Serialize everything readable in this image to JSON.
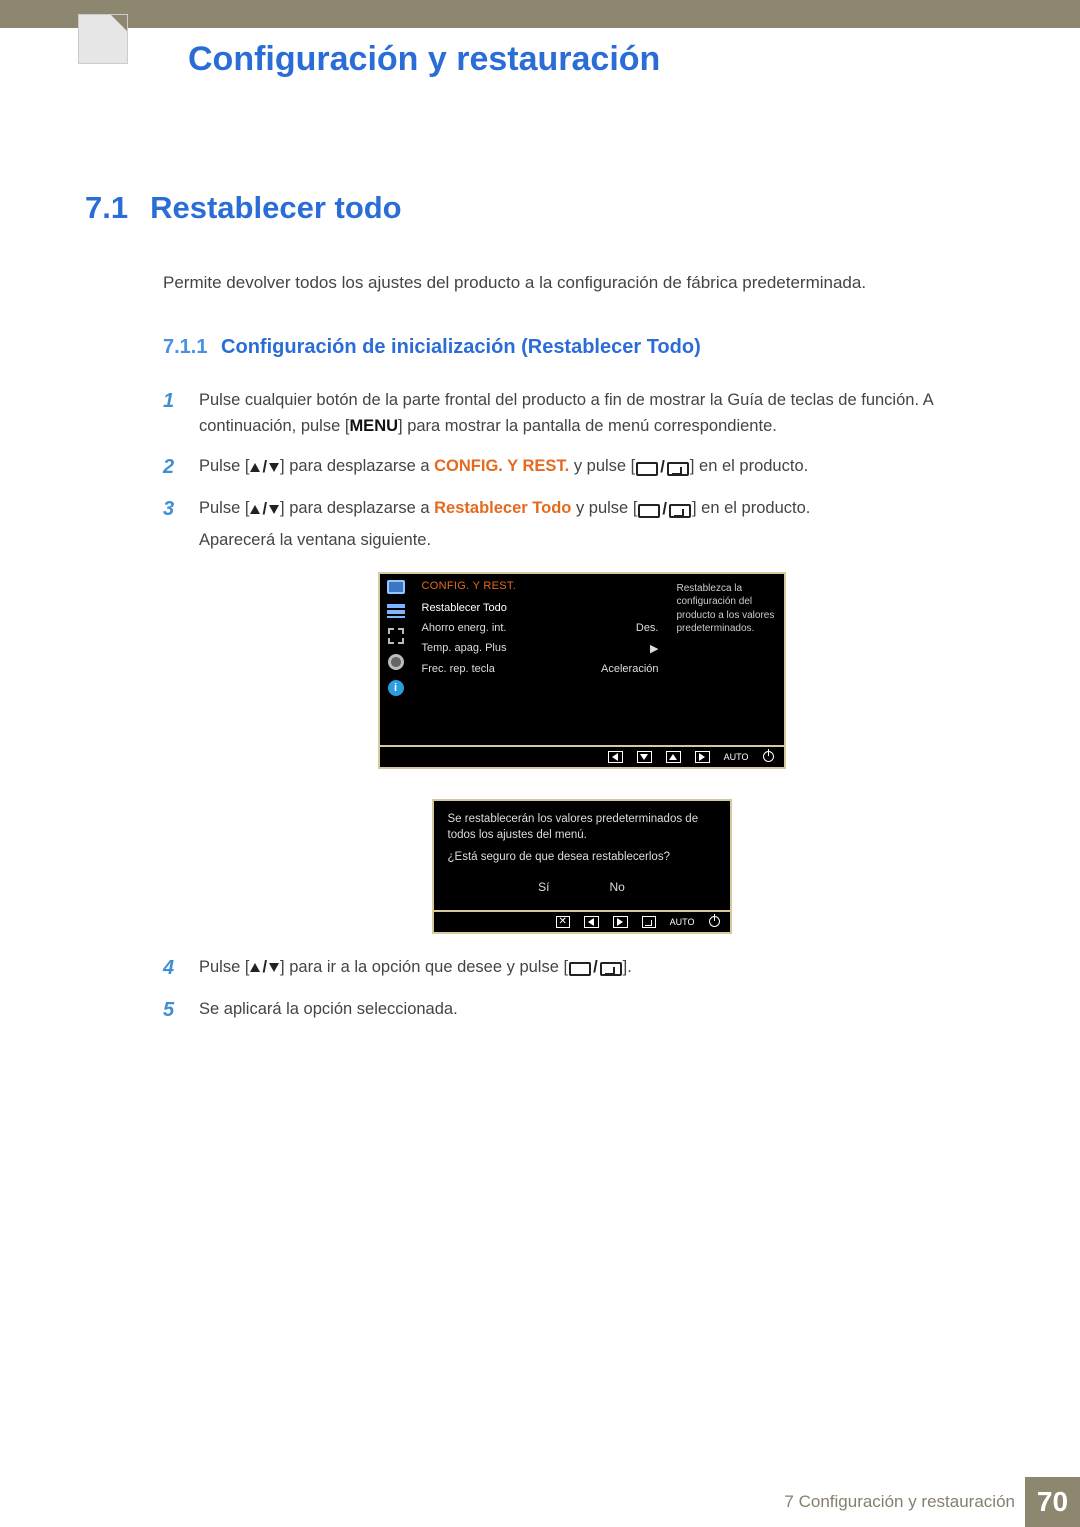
{
  "chapter": {
    "title": "Configuración y restauración"
  },
  "section": {
    "number": "7.1",
    "title": "Restablecer todo",
    "intro": "Permite devolver todos los ajustes del producto a la configuración de fábrica predeterminada."
  },
  "subsection": {
    "number": "7.1.1",
    "title": "Configuración de inicialización (Restablecer Todo)"
  },
  "steps": {
    "s1a": "Pulse cualquier botón de la parte frontal del producto a fin de mostrar la Guía de teclas de función. A continuación, pulse [",
    "s1_menu": "MENU",
    "s1b": "] para mostrar la pantalla de menú correspondiente.",
    "s2a": "Pulse [",
    "s2b": "] para desplazarse a ",
    "s2_kw": "CONFIG. Y REST.",
    "s2c": " y pulse [",
    "s2d": "] en el producto.",
    "s3a": "Pulse [",
    "s3b": "] para desplazarse a ",
    "s3_kw": "Restablecer Todo",
    "s3c": " y pulse [",
    "s3d": "] en el producto.",
    "s3_after": "Aparecerá la ventana siguiente.",
    "s4a": "Pulse [",
    "s4b": "] para ir a la opción que desee y pulse [",
    "s4c": "].",
    "s5": "Se aplicará la opción seleccionada."
  },
  "osd": {
    "header": "CONFIG. Y REST.",
    "rows": [
      {
        "label": "Restablecer Todo",
        "value": ""
      },
      {
        "label": "Ahorro energ. int.",
        "value": "Des."
      },
      {
        "label": "Temp. apag. Plus",
        "value": "▶"
      },
      {
        "label": "Frec. rep. tecla",
        "value": "Aceleración"
      }
    ],
    "help": "Restablezca la configuración del producto a los valores predeterminados.",
    "auto": "AUTO"
  },
  "dialog": {
    "line1": "Se restablecerán los valores predeterminados de todos los ajustes del menú.",
    "line2": "¿Está seguro de que desea restablecerlos?",
    "yes": "Sí",
    "no": "No",
    "auto": "AUTO"
  },
  "footer": {
    "chapter_num": "7",
    "text": "Configuración y restauración",
    "page": "70"
  }
}
